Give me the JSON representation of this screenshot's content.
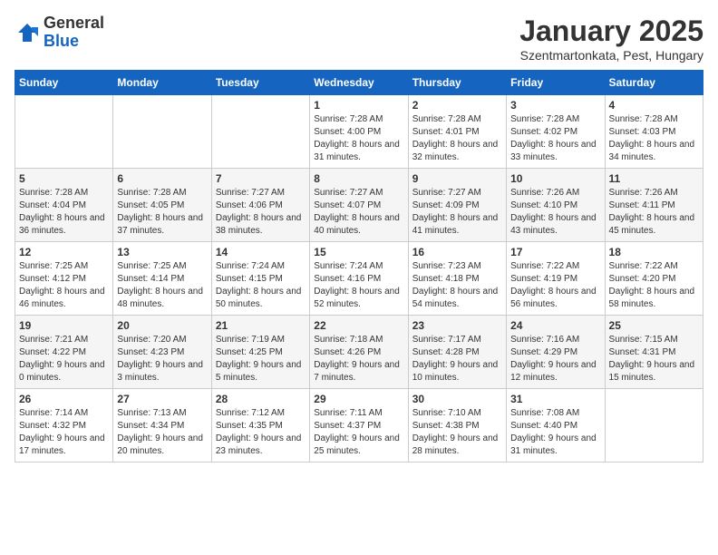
{
  "header": {
    "logo_line1": "General",
    "logo_line2": "Blue",
    "month": "January 2025",
    "location": "Szentmartonkata, Pest, Hungary"
  },
  "days_of_week": [
    "Sunday",
    "Monday",
    "Tuesday",
    "Wednesday",
    "Thursday",
    "Friday",
    "Saturday"
  ],
  "weeks": [
    [
      {
        "day": "",
        "info": ""
      },
      {
        "day": "",
        "info": ""
      },
      {
        "day": "",
        "info": ""
      },
      {
        "day": "1",
        "info": "Sunrise: 7:28 AM\nSunset: 4:00 PM\nDaylight: 8 hours and 31 minutes."
      },
      {
        "day": "2",
        "info": "Sunrise: 7:28 AM\nSunset: 4:01 PM\nDaylight: 8 hours and 32 minutes."
      },
      {
        "day": "3",
        "info": "Sunrise: 7:28 AM\nSunset: 4:02 PM\nDaylight: 8 hours and 33 minutes."
      },
      {
        "day": "4",
        "info": "Sunrise: 7:28 AM\nSunset: 4:03 PM\nDaylight: 8 hours and 34 minutes."
      }
    ],
    [
      {
        "day": "5",
        "info": "Sunrise: 7:28 AM\nSunset: 4:04 PM\nDaylight: 8 hours and 36 minutes."
      },
      {
        "day": "6",
        "info": "Sunrise: 7:28 AM\nSunset: 4:05 PM\nDaylight: 8 hours and 37 minutes."
      },
      {
        "day": "7",
        "info": "Sunrise: 7:27 AM\nSunset: 4:06 PM\nDaylight: 8 hours and 38 minutes."
      },
      {
        "day": "8",
        "info": "Sunrise: 7:27 AM\nSunset: 4:07 PM\nDaylight: 8 hours and 40 minutes."
      },
      {
        "day": "9",
        "info": "Sunrise: 7:27 AM\nSunset: 4:09 PM\nDaylight: 8 hours and 41 minutes."
      },
      {
        "day": "10",
        "info": "Sunrise: 7:26 AM\nSunset: 4:10 PM\nDaylight: 8 hours and 43 minutes."
      },
      {
        "day": "11",
        "info": "Sunrise: 7:26 AM\nSunset: 4:11 PM\nDaylight: 8 hours and 45 minutes."
      }
    ],
    [
      {
        "day": "12",
        "info": "Sunrise: 7:25 AM\nSunset: 4:12 PM\nDaylight: 8 hours and 46 minutes."
      },
      {
        "day": "13",
        "info": "Sunrise: 7:25 AM\nSunset: 4:14 PM\nDaylight: 8 hours and 48 minutes."
      },
      {
        "day": "14",
        "info": "Sunrise: 7:24 AM\nSunset: 4:15 PM\nDaylight: 8 hours and 50 minutes."
      },
      {
        "day": "15",
        "info": "Sunrise: 7:24 AM\nSunset: 4:16 PM\nDaylight: 8 hours and 52 minutes."
      },
      {
        "day": "16",
        "info": "Sunrise: 7:23 AM\nSunset: 4:18 PM\nDaylight: 8 hours and 54 minutes."
      },
      {
        "day": "17",
        "info": "Sunrise: 7:22 AM\nSunset: 4:19 PM\nDaylight: 8 hours and 56 minutes."
      },
      {
        "day": "18",
        "info": "Sunrise: 7:22 AM\nSunset: 4:20 PM\nDaylight: 8 hours and 58 minutes."
      }
    ],
    [
      {
        "day": "19",
        "info": "Sunrise: 7:21 AM\nSunset: 4:22 PM\nDaylight: 9 hours and 0 minutes."
      },
      {
        "day": "20",
        "info": "Sunrise: 7:20 AM\nSunset: 4:23 PM\nDaylight: 9 hours and 3 minutes."
      },
      {
        "day": "21",
        "info": "Sunrise: 7:19 AM\nSunset: 4:25 PM\nDaylight: 9 hours and 5 minutes."
      },
      {
        "day": "22",
        "info": "Sunrise: 7:18 AM\nSunset: 4:26 PM\nDaylight: 9 hours and 7 minutes."
      },
      {
        "day": "23",
        "info": "Sunrise: 7:17 AM\nSunset: 4:28 PM\nDaylight: 9 hours and 10 minutes."
      },
      {
        "day": "24",
        "info": "Sunrise: 7:16 AM\nSunset: 4:29 PM\nDaylight: 9 hours and 12 minutes."
      },
      {
        "day": "25",
        "info": "Sunrise: 7:15 AM\nSunset: 4:31 PM\nDaylight: 9 hours and 15 minutes."
      }
    ],
    [
      {
        "day": "26",
        "info": "Sunrise: 7:14 AM\nSunset: 4:32 PM\nDaylight: 9 hours and 17 minutes."
      },
      {
        "day": "27",
        "info": "Sunrise: 7:13 AM\nSunset: 4:34 PM\nDaylight: 9 hours and 20 minutes."
      },
      {
        "day": "28",
        "info": "Sunrise: 7:12 AM\nSunset: 4:35 PM\nDaylight: 9 hours and 23 minutes."
      },
      {
        "day": "29",
        "info": "Sunrise: 7:11 AM\nSunset: 4:37 PM\nDaylight: 9 hours and 25 minutes."
      },
      {
        "day": "30",
        "info": "Sunrise: 7:10 AM\nSunset: 4:38 PM\nDaylight: 9 hours and 28 minutes."
      },
      {
        "day": "31",
        "info": "Sunrise: 7:08 AM\nSunset: 4:40 PM\nDaylight: 9 hours and 31 minutes."
      },
      {
        "day": "",
        "info": ""
      }
    ]
  ]
}
